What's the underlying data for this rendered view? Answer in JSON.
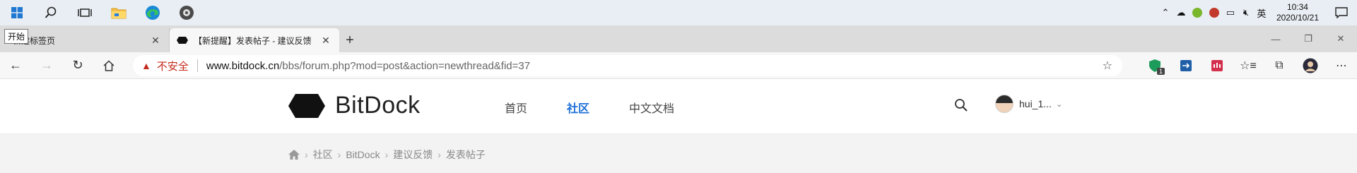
{
  "taskbar": {
    "start_tooltip": "开始",
    "tray": {
      "ime": "英",
      "clock_time": "10:34",
      "clock_date": "2020/10/21"
    }
  },
  "browser": {
    "tabs": [
      {
        "title": "新建标签页",
        "active": false
      },
      {
        "title": "【新提醒】发表帖子 - 建议反馈",
        "active": true
      }
    ],
    "address": {
      "security_label": "不安全",
      "url_domain": "www.bitdock.cn",
      "url_path": "/bbs/forum.php?mod=post&action=newthread&fid=37"
    },
    "extension_badge": "1"
  },
  "site": {
    "logo_text": "BitDock",
    "nav": [
      {
        "label": "首页",
        "active": false
      },
      {
        "label": "社区",
        "active": true
      },
      {
        "label": "中文文档",
        "active": false
      }
    ],
    "username": "hui_1...",
    "breadcrumb": [
      "社区",
      "BitDock",
      "建议反馈",
      "发表帖子"
    ]
  },
  "colors": {
    "accent": "#1d6fd6",
    "insecure": "#c42b1c"
  }
}
